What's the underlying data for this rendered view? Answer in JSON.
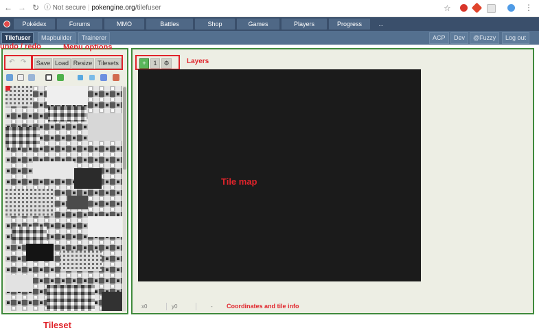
{
  "browser": {
    "security": "Not secure",
    "url_host": "pokengine.org",
    "url_path": "/tilefuser"
  },
  "nav": {
    "items": [
      "Pokédex",
      "Forums",
      "MMO",
      "Battles",
      "Shop",
      "Games",
      "Players",
      "Progress",
      "..."
    ]
  },
  "subnav": {
    "tabs": [
      "Tilefuser",
      "Mapbuilder",
      "Trainerer"
    ],
    "right": [
      "ACP",
      "Dev",
      "@Fuzzy",
      "Log out"
    ]
  },
  "toolbar": {
    "save_label": "Save",
    "load_label": "Load",
    "resize_label": "Resize",
    "tilesets_label": "Tilesets"
  },
  "layers": {
    "add_label": "+",
    "layer_label": "1"
  },
  "status": {
    "x_label": "x0",
    "y_label": "y0",
    "dash": "-"
  },
  "annotations": {
    "undo_redo": "undo / redo",
    "menu_options": "Menu options",
    "layers": "Layers",
    "tile_map": "Tile map",
    "coords": "Coordinates and tile info",
    "tileset": "Tileset"
  },
  "colors": {
    "nav_bg": "#3a4f6b",
    "panel_border": "#3f8a3c",
    "annotation_red": "#e0242b",
    "map_bg": "#1b1b1b"
  }
}
